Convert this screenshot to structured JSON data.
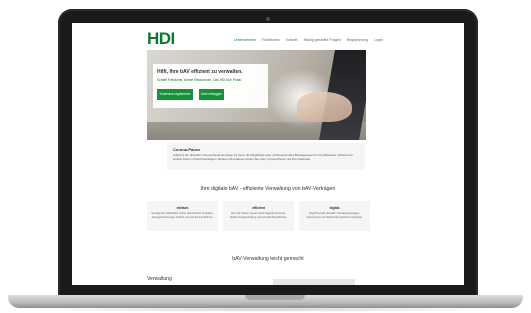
{
  "header": {
    "logo": "HDI",
    "nav": [
      "Unternehmen",
      "Funktionen",
      "Vorteile",
      "Häufig gestellte Fragen",
      "Registrierung",
      "Login"
    ],
    "active_nav": 0
  },
  "hero": {
    "title": "Hilft, Ihre bAV effizient zu verwalten.",
    "subtitle": "Schafft Freiräume, sichert Ressourcen. Das HDI bAV Portal.",
    "primary_button": "Kostenlos registrieren",
    "secondary_button": "Jetzt einloggen"
  },
  "corona": {
    "title": "Corona-Pause",
    "text": "Aufgrund der aktuellen Corona-Pandemie bieten wir Ihnen die Möglichkeit einer vorübergehenden Beitragspause für Ihre Mitarbeiter. Schnell und einfach direkt im Portal beantragen. Weitere Informationen finden Sie unter „Corona-Pause“ auf Ihrer Startseite."
  },
  "section_title": "Ihre digitale bAV - effiziente Verwaltung von bAV-Verträgen",
  "features": [
    {
      "title": "einfach",
      "text": "Verträge der Mitarbeiter online übersichtlich verwalten, Vertragsänderungen einfach und schnell durchführen."
    },
    {
      "title": "effizient",
      "text": "Zeit und Kosten sparen durch digitale Prozesse, direkte Antragsstellung und schnelle Bearbeitung."
    },
    {
      "title": "digital",
      "text": "Zugriff auf alle aktuellen Vertragsunterlagen, Dokumente und Nachrichten jederzeit verfügbar."
    }
  ],
  "section_title_2": "bAV-Verwaltung leicht gemacht",
  "bottom_label": "Verwaltung",
  "colors": {
    "brand_green": "#0b7a2e",
    "button_green": "#1a8f3a",
    "frame": "#1a1a1a"
  }
}
